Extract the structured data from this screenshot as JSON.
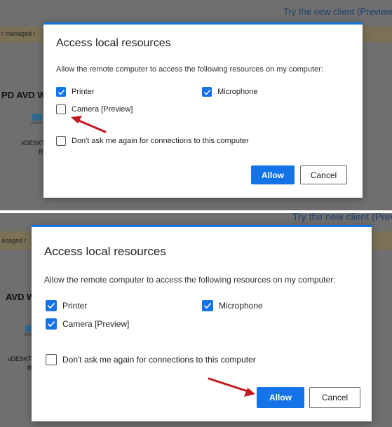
{
  "background": {
    "try_new_client": "Try the new client (Preview)",
    "try_new_client_cut": "Try the new client (Prev",
    "banner_text_top": "r managed r",
    "banner_text_bottom": "anaged r",
    "workspace_heading_top": "PD AVD W",
    "workspace_heading_bottom": "AVD W",
    "tile_label_top": "vDESKT",
    "tile_label_top_2": "R",
    "tile_label_bottom": "vDESKT",
    "tile_label_bottom_2": "R"
  },
  "dialog": {
    "title": "Access local resources",
    "description": "Allow the remote computer to access the following resources on my computer:",
    "options": {
      "printer": "Printer",
      "microphone": "Microphone",
      "camera": "Camera [Preview]",
      "dont_ask": "Don't ask me again for connections to this computer"
    },
    "buttons": {
      "allow": "Allow",
      "cancel": "Cancel"
    }
  },
  "states": {
    "before": {
      "printer": true,
      "microphone": true,
      "camera": false,
      "dont_ask": false
    },
    "after": {
      "printer": true,
      "microphone": true,
      "camera": true,
      "dont_ask": false
    }
  },
  "colors": {
    "accent": "#1473e6",
    "overlay": "#6f6f6f",
    "banner": "#7a7157",
    "annotation_arrow": "#c4161c"
  },
  "icons": {
    "checkmark": "checkmark-icon",
    "monitor": "monitor-icon",
    "arrow": "annotation-arrow-icon"
  }
}
